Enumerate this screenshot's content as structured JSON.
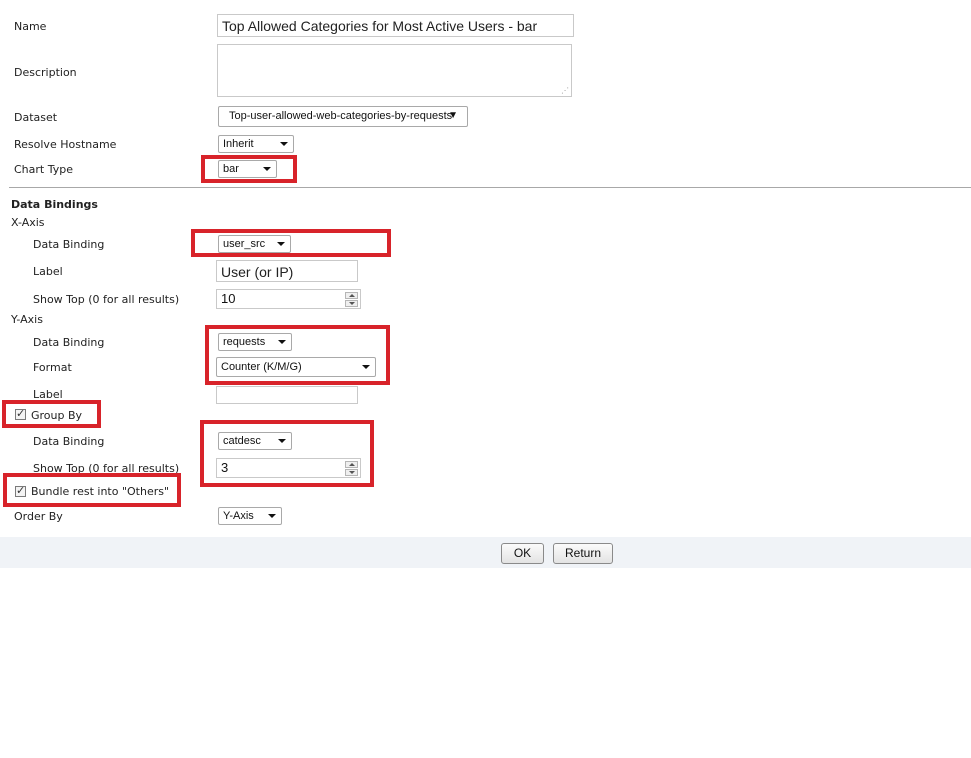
{
  "form": {
    "name_label": "Name",
    "name_value": "Top Allowed Categories for Most Active Users - bar",
    "description_label": "Description",
    "description_value": "",
    "dataset_label": "Dataset",
    "dataset_value": "Top-user-allowed-web-categories-by-requests",
    "resolve_hostname_label": "Resolve Hostname",
    "resolve_hostname_value": "Inherit",
    "chart_type_label": "Chart Type",
    "chart_type_value": "bar"
  },
  "bindings": {
    "section_title": "Data Bindings",
    "x_axis": {
      "title": "X-Axis",
      "data_binding_label": "Data Binding",
      "data_binding_value": "user_src",
      "label_label": "Label",
      "label_value": "User (or IP)",
      "show_top_label": "Show Top (0 for all results)",
      "show_top_value": "10"
    },
    "y_axis": {
      "title": "Y-Axis",
      "data_binding_label": "Data Binding",
      "data_binding_value": "requests",
      "format_label": "Format",
      "format_value": "Counter (K/M/G)",
      "label_label": "Label",
      "label_value": ""
    },
    "group_by": {
      "label": "Group By",
      "checked": true,
      "data_binding_label": "Data Binding",
      "data_binding_value": "catdesc",
      "show_top_label": "Show Top (0 for all results)",
      "show_top_value": "3"
    },
    "bundle": {
      "label": "Bundle rest into \"Others\"",
      "checked": true
    },
    "order_by_label": "Order By",
    "order_by_value": "Y-Axis"
  },
  "footer": {
    "ok_label": "OK",
    "return_label": "Return"
  },
  "colors": {
    "highlight": "#d8232a",
    "footer_bg": "#f0f3f7"
  }
}
